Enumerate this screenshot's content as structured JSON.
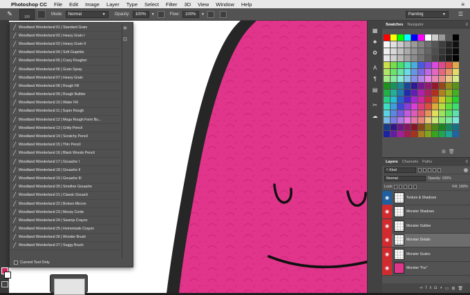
{
  "menubar": {
    "apple": "",
    "app": "Photoshop CC",
    "items": [
      "File",
      "Edit",
      "Image",
      "Layer",
      "Type",
      "Select",
      "Filter",
      "3D",
      "View",
      "Window",
      "Help"
    ],
    "menu_icon": "≡"
  },
  "options": {
    "brush_size": "100",
    "mode_label": "Mode:",
    "mode_value": "Normal",
    "opacity_label": "Opacity:",
    "opacity_value": "100%",
    "flow_label": "Flow:",
    "flow_value": "100%",
    "workspace": "Painting"
  },
  "brushes": [
    "Woodland Wonderland 01 | Standard Grain",
    "Woodland Wonderland 02 | Heavy Grain I",
    "Woodland Wonderland 03 | Heavy Grain II",
    "Woodland Wonderland 04 | Soft Graphite",
    "Woodland Wonderland 05 | Crazy Rougher",
    "Woodland Wonderland 06 | Grain Spray",
    "Woodland Wonderland 07 | Heavy Grain",
    "Woodland Wonderland 08 | Rough Fill",
    "Woodland Wonderland 09 | Rough Builder",
    "Woodland Wonderland 10 | Water Fill",
    "Woodland Wonderland 11 | Super Rough",
    "Woodland Wonderland 12 | Mega Rough Form Bu...",
    "Woodland Wonderland 13 | Gritty Pencil",
    "Woodland Wonderland 14 | Scratchy Pencil",
    "Woodland Wonderland 15 | Thin Pencil",
    "Woodland Wonderland 16 | Black Woods Pencil",
    "Woodland Wonderland 17 | Gouache I",
    "Woodland Wonderland 18 | Gouache II",
    "Woodland Wonderland 19 | Gouache III",
    "Woodland Wonderland 20 | Smother Gouache",
    "Woodland Wonderland 21 | Classic Gouach",
    "Woodland Wonderland 22 | Broken Micron",
    "Woodland Wonderland 23 | Messy Conte",
    "Woodland Wonderland 24 | Swamp Crayon",
    "Woodland Wonderland 25 | Homemade Crayon",
    "Woodland Wonderland 26 | Wonder Brush",
    "Woodland Wonderland 27 | Soggy Brush"
  ],
  "brush_footer": "Current Tool Only",
  "panels": {
    "swatches_tab": "Swatches",
    "navigator_tab": "Navigator",
    "layers_tab": "Layers",
    "channels_tab": "Channels",
    "paths_tab": "Paths",
    "kind": "Kind",
    "blend": "Normal",
    "opacity_label": "Opacity:",
    "opacity_value": "100%",
    "lock_label": "Lock:",
    "fill_label": "Fill:",
    "fill_value": "100%"
  },
  "layers": [
    {
      "name": "Texture & Shadows"
    },
    {
      "name": "Monster Shadows"
    },
    {
      "name": "Monster Outline"
    },
    {
      "name": "Monster Details"
    },
    {
      "name": "Monster Scales"
    },
    {
      "name": "Monster \"Fur\""
    }
  ],
  "colors": {
    "accent_red": "#d12b30",
    "monster_pink": "#e0358a",
    "foreground": "#d0245e"
  }
}
